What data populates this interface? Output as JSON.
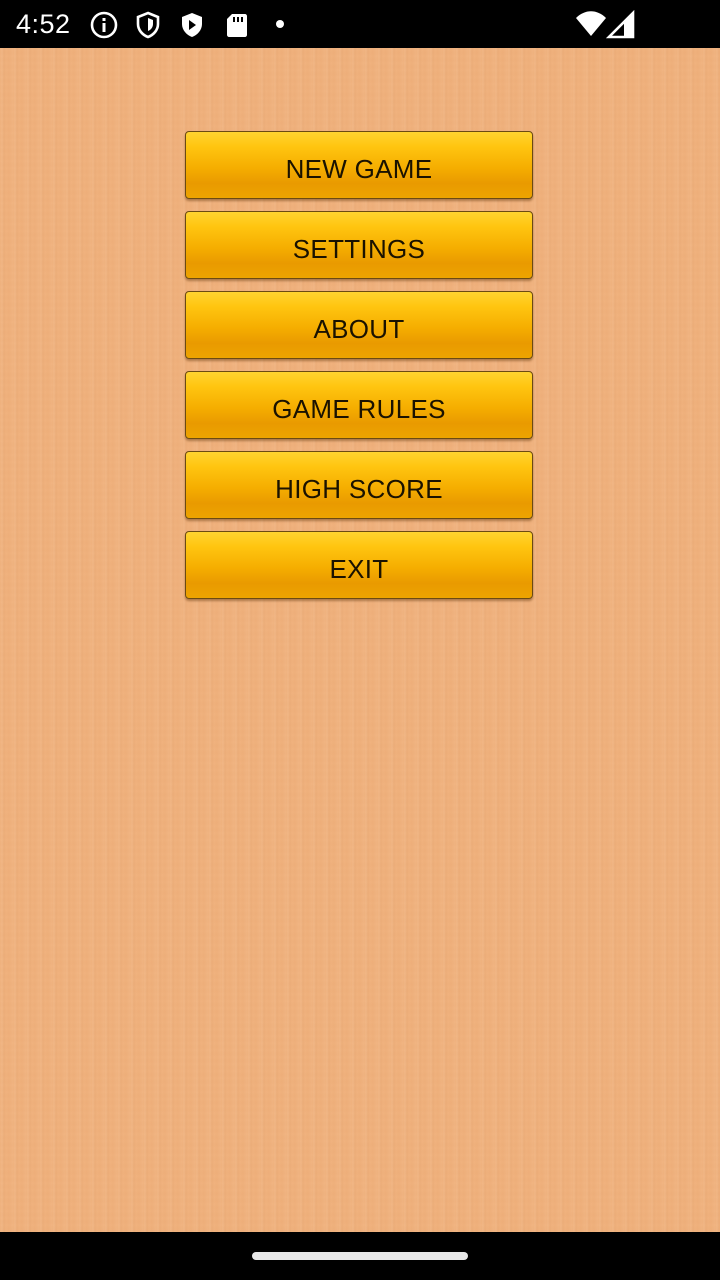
{
  "status_bar": {
    "time": "4:52",
    "icons": [
      "info-icon",
      "shield-icon",
      "play-protect-icon",
      "sd-card-icon",
      "notification-dot-icon",
      "wifi-icon",
      "signal-icon"
    ]
  },
  "menu": {
    "buttons": [
      {
        "label": "NEW GAME"
      },
      {
        "label": "SETTINGS"
      },
      {
        "label": "ABOUT"
      },
      {
        "label": "GAME RULES"
      },
      {
        "label": "HIGH SCORE"
      },
      {
        "label": "EXIT"
      }
    ]
  },
  "colors": {
    "background": "#f0b27e",
    "button_top": "#ffd430",
    "button_bottom": "#e99a00",
    "button_text": "#1a1200"
  }
}
